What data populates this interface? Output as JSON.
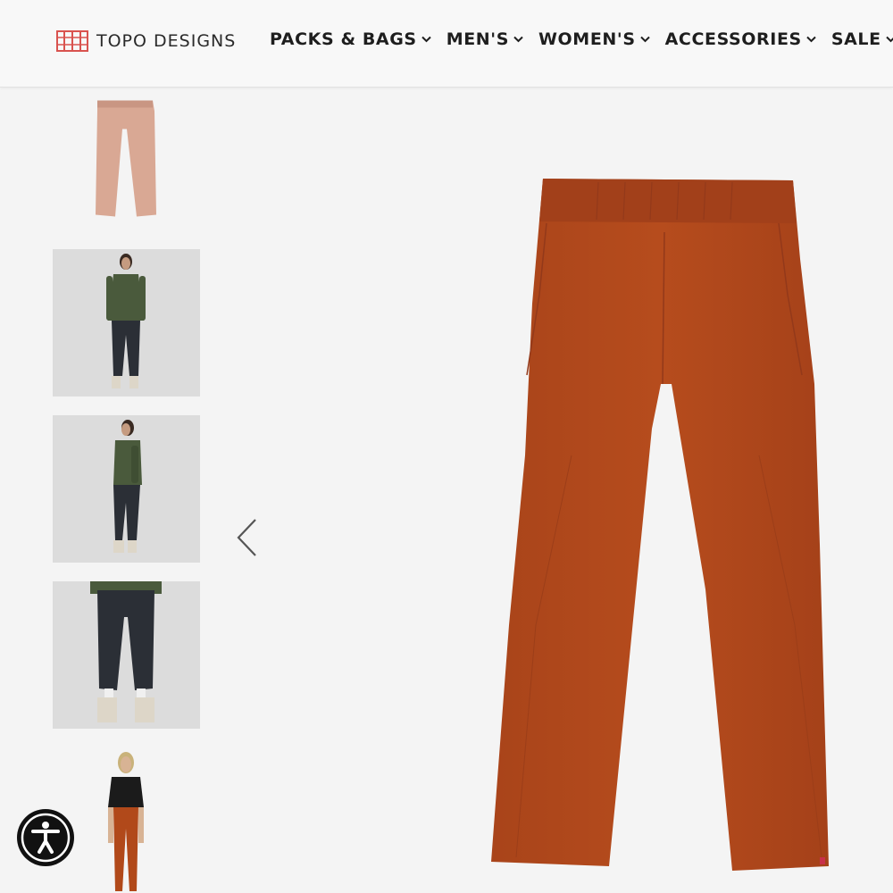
{
  "header": {
    "logo_text": "TOPO DESIGNS",
    "logo_icon": "folded-map-icon",
    "nav": [
      {
        "label": "PACKS & BAGS",
        "icon": "chevron-down-icon"
      },
      {
        "label": "MEN'S",
        "icon": "chevron-down-icon"
      },
      {
        "label": "WOMEN'S",
        "icon": "chevron-down-icon"
      },
      {
        "label": "ACCESSORIES",
        "icon": "chevron-down-icon"
      },
      {
        "label": "SALE",
        "icon": "chevron-down-icon"
      }
    ]
  },
  "gallery": {
    "prev_icon": "chevron-left-icon",
    "main_image_color": "#b1491a",
    "thumbnails": [
      "pink-pants-flat",
      "model-front",
      "model-side",
      "model-pants-closeup",
      "model-orange-pants"
    ]
  },
  "accessibility": {
    "icon": "accessibility-person-icon"
  },
  "colors": {
    "brand_red": "#d9534f",
    "rust": "#b1491a",
    "pink": "#d9a894",
    "olive": "#4a5a3c",
    "charcoal": "#2b2f36"
  }
}
